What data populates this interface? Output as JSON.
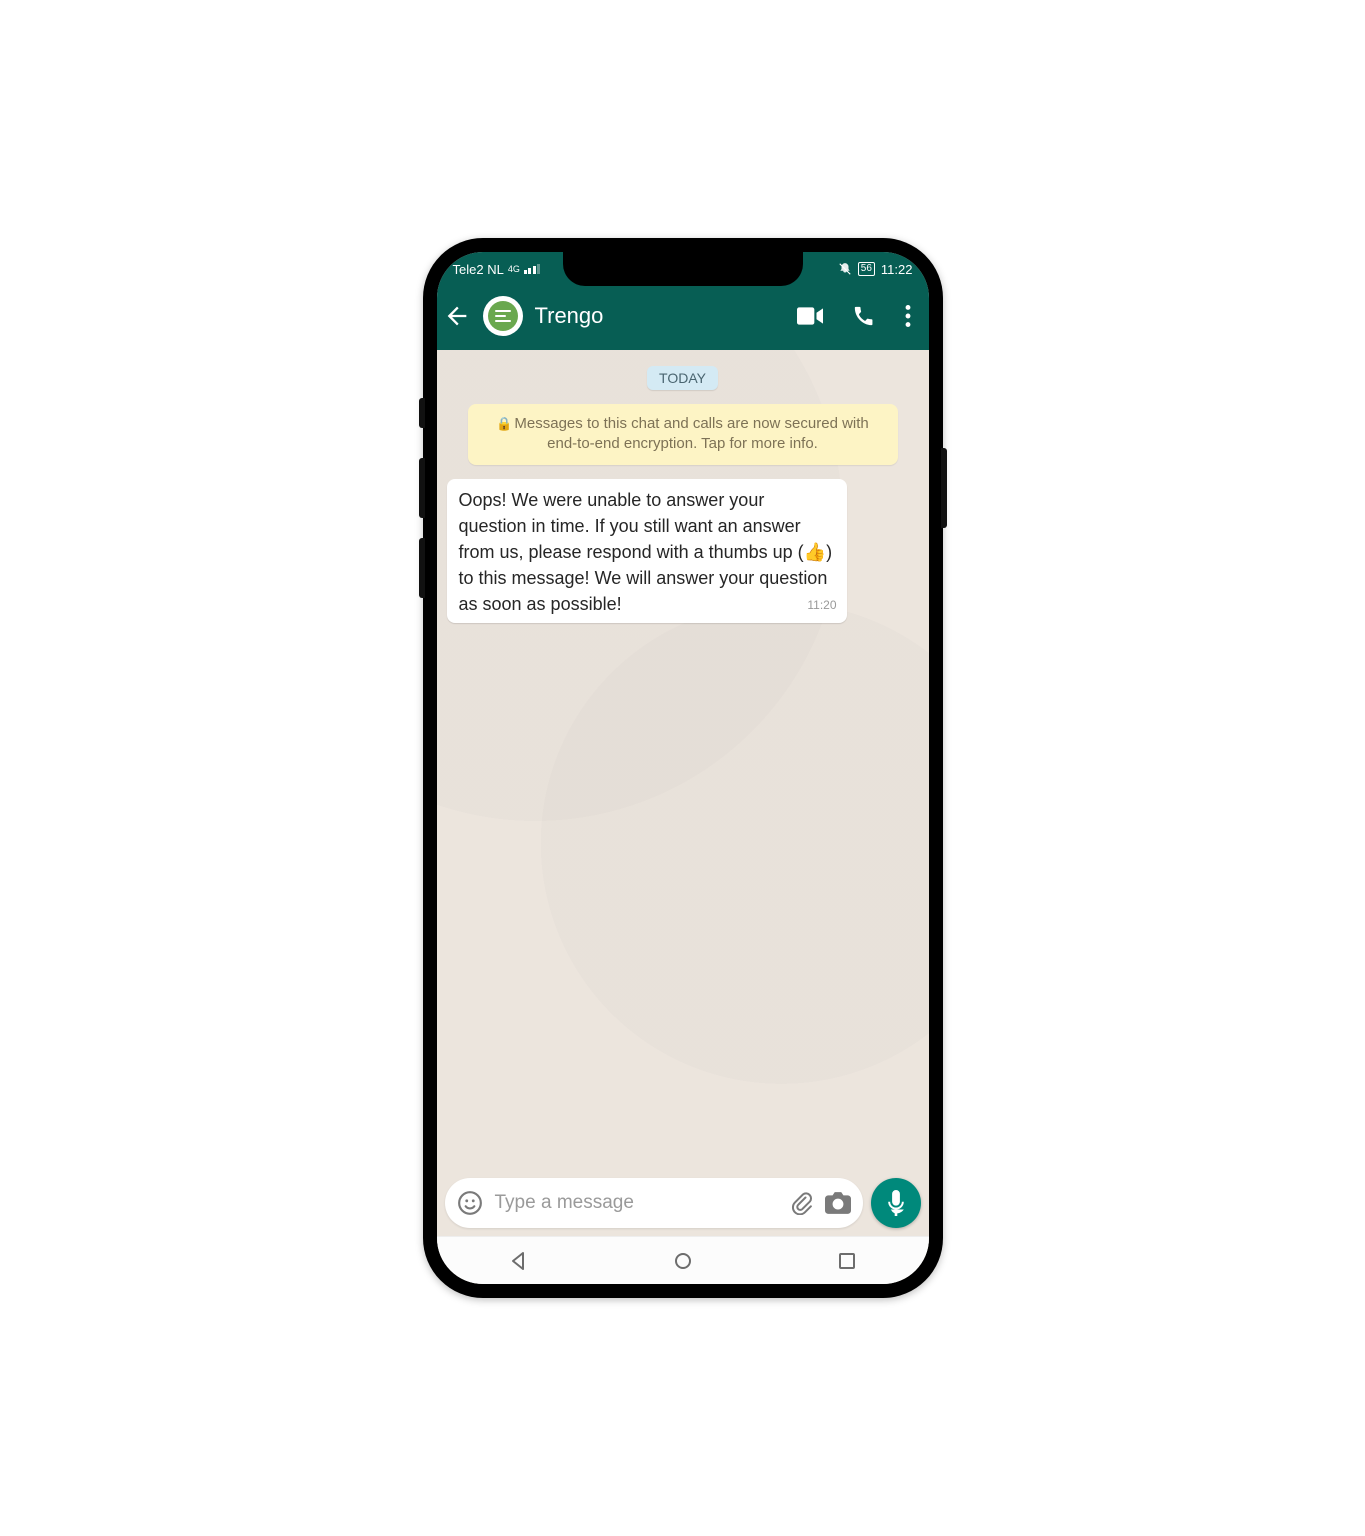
{
  "status": {
    "carrier": "Tele2 NL",
    "net_label": "4G",
    "battery": "56",
    "time": "11:22"
  },
  "header": {
    "contact_name": "Trengo"
  },
  "chat": {
    "date_label": "TODAY",
    "encryption_notice": "Messages to this chat and calls are now secured with end-to-end encryption. Tap for more info.",
    "message_text": "Oops! We were unable to answer your question in time. If you still want an answer from us, please respond with a thumbs up (👍) to this message! We will answer your question as soon as possible!",
    "message_time": "11:20"
  },
  "composer": {
    "placeholder": "Type a message"
  }
}
